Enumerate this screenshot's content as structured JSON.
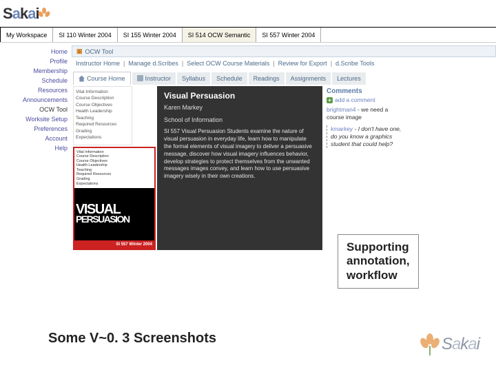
{
  "brand": {
    "name": "Sakai"
  },
  "tabs": [
    {
      "label": "My Workspace"
    },
    {
      "label": "SI 110 Winter 2004"
    },
    {
      "label": "SI 155 Winter 2004"
    },
    {
      "label": "SI 514 OCW Semantic"
    },
    {
      "label": "SI 557 Winter 2004"
    }
  ],
  "sidenav": [
    "Home",
    "Profile",
    "Membership",
    "Schedule",
    "Resources",
    "Announcements",
    "OCW Tool",
    "Worksite Setup",
    "Preferences",
    "Account",
    "Help"
  ],
  "tool": {
    "icon_label": "▣",
    "title": "OCW Tool"
  },
  "subnav": [
    "Instructor Home",
    "Manage d.Scribes",
    "Select OCW Course Materials",
    "Review for Export",
    "d.Scribe Tools"
  ],
  "course_tabs": [
    "Course Home",
    "Instructor",
    "Syllabus",
    "Schedule",
    "Readings",
    "Assignments",
    "Lectures"
  ],
  "left_list": [
    "Vital Information",
    "Course Description",
    "Course Objectives",
    "Health Leadership",
    "Teaching",
    "Required Resources",
    "Grading",
    "Expectations"
  ],
  "cover": {
    "list": [
      "Vital Information",
      "Course Description",
      "Course Objectives",
      "Health Leadership",
      "Teaching",
      "Required Resources",
      "Grading",
      "Expectations"
    ],
    "big1": "VISUAL",
    "big2": "PERSUASION",
    "strip": "SI 557 Winter 2004"
  },
  "center": {
    "title": "Visual Persuasion",
    "instructor": "Karen Markey",
    "school": "School of Information",
    "desc": "SI 557 Visual Persuasion Students examine the nature of visual persuasion in everyday life, learn how to manipulate the formal elements of visual imagery to deliver a persuasive message, discover how visual imagery influences behavior, develop strategies to protect themselves from the unwanted messages images convey, and learn how to use persuasive imagery wisely in their own creations."
  },
  "comments": {
    "heading": "Comments",
    "add": "add a comment",
    "items": [
      {
        "user": "brightman4",
        "text": "we need a course image"
      },
      {
        "user": "kmarkey",
        "text": "I don't have one, do you know a graphics student that could help?",
        "reply": true
      }
    ]
  },
  "callout": {
    "l1": "Supporting",
    "l2": "annotation,",
    "l3": "workflow"
  },
  "footer_caption": "Some V~0. 3 Screenshots",
  "footer_brand": "Sakai"
}
